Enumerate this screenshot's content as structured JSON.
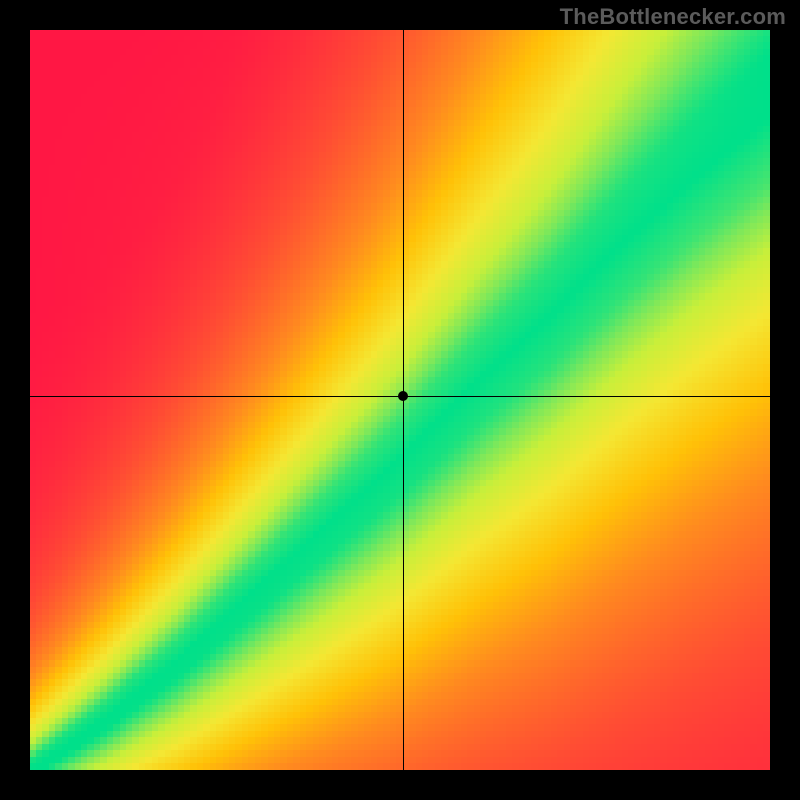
{
  "watermark": "TheBottlenecker.com",
  "chart_data": {
    "type": "heatmap",
    "title": "",
    "xlabel": "",
    "ylabel": "",
    "xlim": [
      0,
      1
    ],
    "ylim": [
      0,
      1
    ],
    "grid": false,
    "legend": false,
    "crosshair": {
      "x": 0.504,
      "y": 0.506
    },
    "marker": {
      "x": 0.504,
      "y": 0.506
    },
    "pixelation": 115,
    "color_stops": [
      {
        "t": 0.0,
        "hex": "#ff1744"
      },
      {
        "t": 0.2,
        "hex": "#ff4d33"
      },
      {
        "t": 0.4,
        "hex": "#ff8a1f"
      },
      {
        "t": 0.55,
        "hex": "#ffc107"
      },
      {
        "t": 0.7,
        "hex": "#f4e733"
      },
      {
        "t": 0.82,
        "hex": "#c8ef3a"
      },
      {
        "t": 0.9,
        "hex": "#7ee85a"
      },
      {
        "t": 1.0,
        "hex": "#00e08a"
      }
    ],
    "optimal_curve": {
      "description": "thin green band along a slightly super-linear diagonal; band widens toward upper-right",
      "points_xy": [
        [
          0.0,
          0.0
        ],
        [
          0.1,
          0.07
        ],
        [
          0.2,
          0.15
        ],
        [
          0.3,
          0.24
        ],
        [
          0.4,
          0.33
        ],
        [
          0.5,
          0.42
        ],
        [
          0.6,
          0.52
        ],
        [
          0.7,
          0.61
        ],
        [
          0.8,
          0.71
        ],
        [
          0.9,
          0.8
        ],
        [
          1.0,
          0.88
        ]
      ],
      "band_halfwidth_start": 0.01,
      "band_halfwidth_end": 0.085
    }
  }
}
